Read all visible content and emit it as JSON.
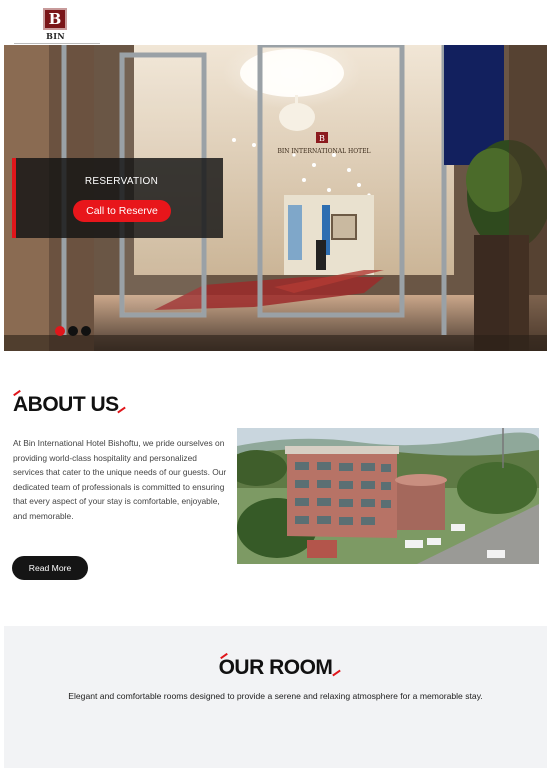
{
  "header": {
    "logo_letter": "B",
    "logo_name": "BIN"
  },
  "hero": {
    "reservation_title": "RESERVATION",
    "reserve_button": "Call to Reserve",
    "slide_count": 3,
    "active_slide": 1,
    "sign_letter": "B",
    "sign_text": "BIN INTERNATIONAL HOTEL"
  },
  "about": {
    "title": "ABOUT US",
    "text": "At Bin International Hotel Bishoftu, we pride ourselves on providing world-class hospitality and personalized services that cater to the unique needs of our guests. Our dedicated team of professionals is committed to ensuring that every aspect of your stay is comfortable, enjoyable, and memorable.",
    "read_more": "Read More"
  },
  "rooms": {
    "title": "OUR ROOM",
    "subtitle": "Elegant and comfortable rooms designed to provide a serene and relaxing atmosphere for a memorable stay."
  },
  "colors": {
    "accent": "#e0161b",
    "dark": "#151515",
    "brand": "#7a1518"
  }
}
